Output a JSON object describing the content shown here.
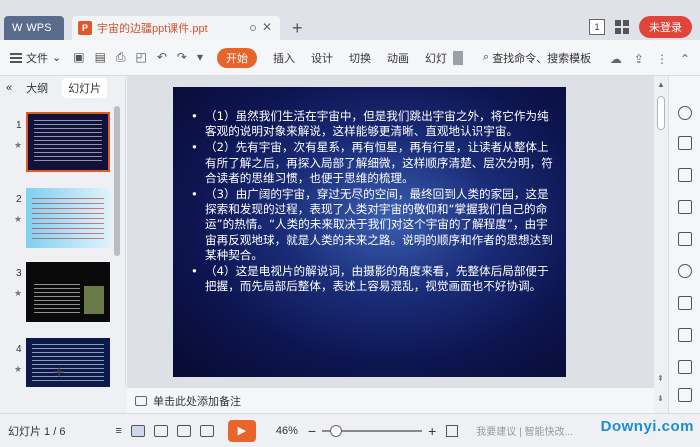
{
  "titlebar": {
    "wps_tab": "WPS",
    "doc_tab": "宇宙的边疆ppt课件.ppt",
    "doc_icon": "P",
    "new_tab": "+",
    "badge": "1",
    "login": "未登录"
  },
  "menubar": {
    "file": "文件",
    "items": [
      "开始",
      "插入",
      "设计",
      "切换",
      "动画",
      "幻灯"
    ],
    "search": "查找命令、搜索模板"
  },
  "leftpanel": {
    "tabs": [
      "大纲",
      "幻灯片"
    ],
    "slide_numbers": [
      "1",
      "2",
      "3",
      "4"
    ],
    "star": "★",
    "add": "+"
  },
  "slide": {
    "paragraphs": [
      "（1）虽然我们生活在宇宙中，但是我们跳出宇宙之外，将它作为纯客观的说明对象来解说，这样能够更清晰、直观地认识宇宙。",
      "（2）先有宇宙，次有星系，再有恒星，再有行星，让读者从整体上有所了解之后，再探入局部了解细微，这样顺序清楚、层次分明，符合读者的思维习惯，也便于思维的梳理。",
      "（3）由广阔的宇宙，穿过无尽的空间，最终回到人类的家园，这是探索和发现的过程，表现了人类对宇宙的敬仰和“掌握我们自己的命运”的热情。“人类的未来取决于我们对这个宇宙的了解程度”，由宇宙再反观地球，就是人类的未来之路。说明的顺序和作者的思想达到某种契合。",
      "（4）这是电视片的解说词，由摄影的角度来看，先整体后局部便于把握，而先局部后整体，表述上容易混乱，视觉画面也不好协调。"
    ]
  },
  "notes": {
    "placeholder": "单击此处添加备注"
  },
  "statusbar": {
    "slide_info": "幻灯片 1 / 6",
    "zoom": "46%",
    "zoom_minus": "−",
    "zoom_plus": "+",
    "right_text": "我要建议 | 智能快改..."
  },
  "watermark": "Downyi.com"
}
